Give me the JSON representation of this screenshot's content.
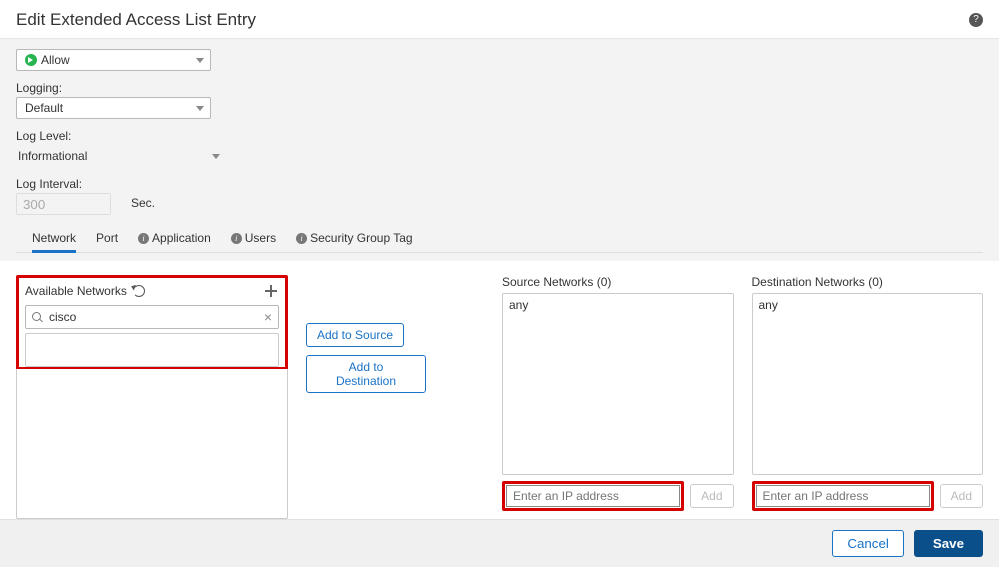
{
  "dialog": {
    "title": "Edit Extended Access List Entry"
  },
  "action": {
    "value": "Allow"
  },
  "logging": {
    "label": "Logging:",
    "value": "Default"
  },
  "log_level": {
    "label": "Log Level:",
    "value": "Informational"
  },
  "log_interval": {
    "label": "Log Interval:",
    "value": "300",
    "unit": "Sec."
  },
  "tabs": {
    "network": "Network",
    "port": "Port",
    "application": "Application",
    "users": "Users",
    "sgt": "Security Group Tag"
  },
  "available": {
    "title": "Available Networks",
    "search_value": "cisco"
  },
  "buttons": {
    "add_source": "Add to Source",
    "add_dest": "Add to Destination",
    "add": "Add"
  },
  "source": {
    "title": "Source Networks (0)",
    "first_item": "any",
    "ip_placeholder": "Enter an IP address"
  },
  "destination": {
    "title": "Destination Networks (0)",
    "first_item": "any",
    "ip_placeholder": "Enter an IP address"
  },
  "footer": {
    "cancel": "Cancel",
    "save": "Save"
  }
}
